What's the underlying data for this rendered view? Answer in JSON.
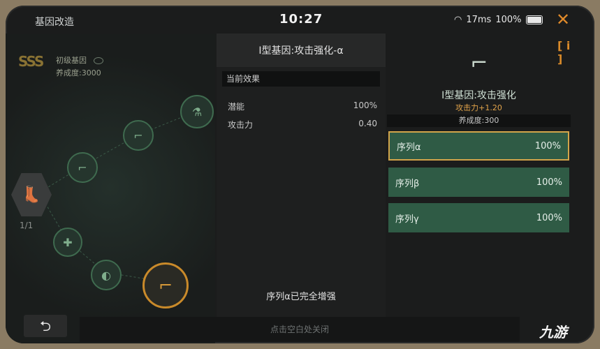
{
  "header": {
    "title": "基因改造",
    "clock": "10:27",
    "network": "17ms",
    "battery": "100%",
    "close_symbol": "✕"
  },
  "tree": {
    "rank_badge": "SSS",
    "gene_name": "初级基因",
    "gene_level": "养成度:3000",
    "slot_count": "1/1",
    "back_symbol": "⮌",
    "node_icons": [
      "flask-icon",
      "gun-icon",
      "gun-icon",
      "medkit-icon",
      "pills-icon",
      "gun-lock-icon",
      "boot-icon"
    ]
  },
  "middle": {
    "title": "I型基因:攻击强化-α",
    "effect_header": "当前效果",
    "rows": [
      {
        "label": "潜能",
        "value": "100%"
      },
      {
        "label": "攻击力",
        "value": "0.40"
      }
    ],
    "footer": "序列α已完全增强"
  },
  "right": {
    "info_label": "[ i ]",
    "title": "I型基因:攻击强化",
    "attribute": "攻击力+1.20",
    "level": "养成度:300",
    "sequences": [
      {
        "label": "序列α",
        "value": "100%",
        "selected": true
      },
      {
        "label": "序列β",
        "value": "100%",
        "selected": false
      },
      {
        "label": "序列γ",
        "value": "100%",
        "selected": false
      }
    ]
  },
  "bottom_hint": "点击空白处关闭",
  "watermark": "九游",
  "colors": {
    "accent_orange": "#d98a2a",
    "sequence_green": "#2f5b45",
    "selected_border": "#d2a44a",
    "attribute_orange": "#e3a44a"
  }
}
